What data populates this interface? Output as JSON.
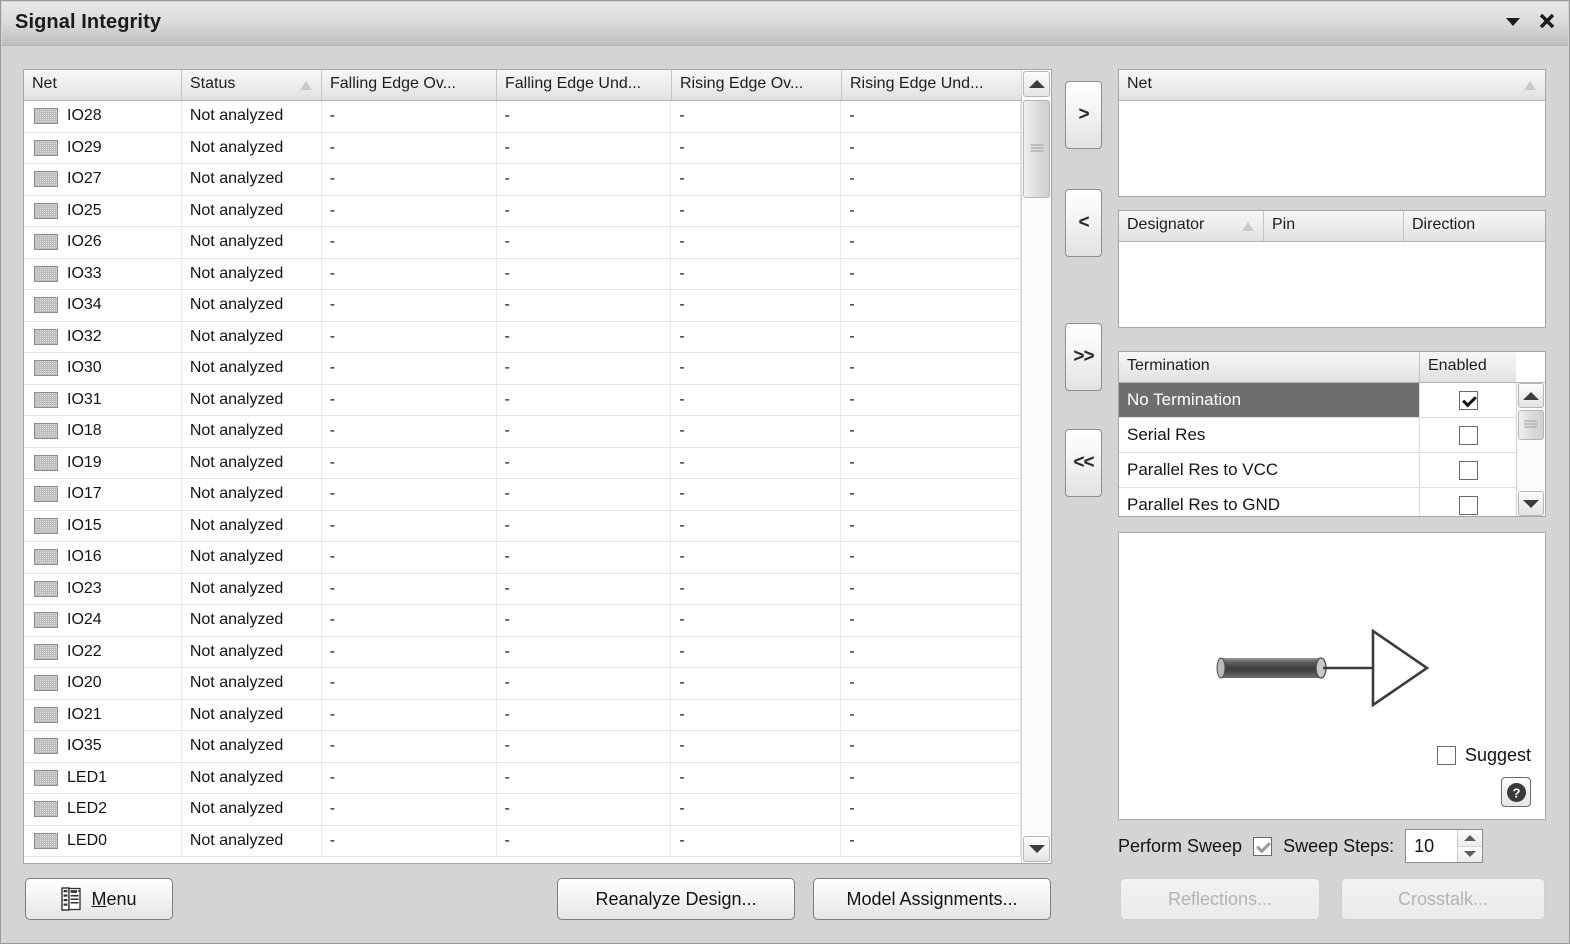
{
  "window": {
    "title": "Signal Integrity",
    "caret_icon": "chevron-down-icon",
    "close_icon": "close-icon"
  },
  "nets_grid": {
    "columns": [
      {
        "label": "Net",
        "sorted": false
      },
      {
        "label": "Status",
        "sorted": true
      },
      {
        "label": "Falling Edge Ov...",
        "sorted": false
      },
      {
        "label": "Falling Edge Und...",
        "sorted": false
      },
      {
        "label": "Rising Edge Ov...",
        "sorted": false
      },
      {
        "label": "Rising Edge Und...",
        "sorted": false
      }
    ],
    "rows": [
      {
        "net": "IO28",
        "status": "Not analyzed",
        "fall_over": "-",
        "fall_under": "-",
        "rise_over": "-",
        "rise_under": "-"
      },
      {
        "net": "IO29",
        "status": "Not analyzed",
        "fall_over": "-",
        "fall_under": "-",
        "rise_over": "-",
        "rise_under": "-"
      },
      {
        "net": "IO27",
        "status": "Not analyzed",
        "fall_over": "-",
        "fall_under": "-",
        "rise_over": "-",
        "rise_under": "-"
      },
      {
        "net": "IO25",
        "status": "Not analyzed",
        "fall_over": "-",
        "fall_under": "-",
        "rise_over": "-",
        "rise_under": "-"
      },
      {
        "net": "IO26",
        "status": "Not analyzed",
        "fall_over": "-",
        "fall_under": "-",
        "rise_over": "-",
        "rise_under": "-"
      },
      {
        "net": "IO33",
        "status": "Not analyzed",
        "fall_over": "-",
        "fall_under": "-",
        "rise_over": "-",
        "rise_under": "-"
      },
      {
        "net": "IO34",
        "status": "Not analyzed",
        "fall_over": "-",
        "fall_under": "-",
        "rise_over": "-",
        "rise_under": "-"
      },
      {
        "net": "IO32",
        "status": "Not analyzed",
        "fall_over": "-",
        "fall_under": "-",
        "rise_over": "-",
        "rise_under": "-"
      },
      {
        "net": "IO30",
        "status": "Not analyzed",
        "fall_over": "-",
        "fall_under": "-",
        "rise_over": "-",
        "rise_under": "-"
      },
      {
        "net": "IO31",
        "status": "Not analyzed",
        "fall_over": "-",
        "fall_under": "-",
        "rise_over": "-",
        "rise_under": "-"
      },
      {
        "net": "IO18",
        "status": "Not analyzed",
        "fall_over": "-",
        "fall_under": "-",
        "rise_over": "-",
        "rise_under": "-"
      },
      {
        "net": "IO19",
        "status": "Not analyzed",
        "fall_over": "-",
        "fall_under": "-",
        "rise_over": "-",
        "rise_under": "-"
      },
      {
        "net": "IO17",
        "status": "Not analyzed",
        "fall_over": "-",
        "fall_under": "-",
        "rise_over": "-",
        "rise_under": "-"
      },
      {
        "net": "IO15",
        "status": "Not analyzed",
        "fall_over": "-",
        "fall_under": "-",
        "rise_over": "-",
        "rise_under": "-"
      },
      {
        "net": "IO16",
        "status": "Not analyzed",
        "fall_over": "-",
        "fall_under": "-",
        "rise_over": "-",
        "rise_under": "-"
      },
      {
        "net": "IO23",
        "status": "Not analyzed",
        "fall_over": "-",
        "fall_under": "-",
        "rise_over": "-",
        "rise_under": "-"
      },
      {
        "net": "IO24",
        "status": "Not analyzed",
        "fall_over": "-",
        "fall_under": "-",
        "rise_over": "-",
        "rise_under": "-"
      },
      {
        "net": "IO22",
        "status": "Not analyzed",
        "fall_over": "-",
        "fall_under": "-",
        "rise_over": "-",
        "rise_under": "-"
      },
      {
        "net": "IO20",
        "status": "Not analyzed",
        "fall_over": "-",
        "fall_under": "-",
        "rise_over": "-",
        "rise_under": "-"
      },
      {
        "net": "IO21",
        "status": "Not analyzed",
        "fall_over": "-",
        "fall_under": "-",
        "rise_over": "-",
        "rise_under": "-"
      },
      {
        "net": "IO35",
        "status": "Not analyzed",
        "fall_over": "-",
        "fall_under": "-",
        "rise_over": "-",
        "rise_under": "-"
      },
      {
        "net": "LED1",
        "status": "Not analyzed",
        "fall_over": "-",
        "fall_under": "-",
        "rise_over": "-",
        "rise_under": "-"
      },
      {
        "net": "LED2",
        "status": "Not analyzed",
        "fall_over": "-",
        "fall_under": "-",
        "rise_over": "-",
        "rise_under": "-"
      },
      {
        "net": "LED0",
        "status": "Not analyzed",
        "fall_over": "-",
        "fall_under": "-",
        "rise_over": "-",
        "rise_under": "-"
      }
    ],
    "scrollbar": {
      "up_icon": "chevron-up-icon",
      "down_icon": "chevron-down-icon"
    }
  },
  "transfer_buttons": [
    {
      "label": ">",
      "name": "move-right-button"
    },
    {
      "label": "<",
      "name": "move-left-button"
    },
    {
      "label": ">>",
      "name": "move-all-right-button"
    },
    {
      "label": "<<",
      "name": "move-all-left-button"
    }
  ],
  "selected_net_panel": {
    "columns": [
      {
        "label": "Net",
        "sorted": true
      }
    ],
    "rows": []
  },
  "pins_panel": {
    "columns": [
      {
        "label": "Designator",
        "sorted": true
      },
      {
        "label": "Pin",
        "sorted": false
      },
      {
        "label": "Direction",
        "sorted": false
      }
    ],
    "rows": []
  },
  "termination_panel": {
    "columns": [
      {
        "label": "Termination"
      },
      {
        "label": "Enabled"
      }
    ],
    "rows": [
      {
        "label": "No Termination",
        "enabled": true,
        "selected": true
      },
      {
        "label": "Serial Res",
        "enabled": false,
        "selected": false
      },
      {
        "label": "Parallel Res to VCC",
        "enabled": false,
        "selected": false
      },
      {
        "label": "Parallel Res to GND",
        "enabled": false,
        "selected": false
      }
    ],
    "scrollbar": {
      "up_icon": "chevron-up-icon",
      "down_icon": "chevron-down-icon"
    }
  },
  "preview_panel": {
    "diagram_icon": "transmission-line-buffer-diagram",
    "suggest_label": "Suggest",
    "suggest_checked": false,
    "help_icon": "help-question-icon"
  },
  "sweep": {
    "perform_label": "Perform Sweep",
    "perform_checked": true,
    "steps_label": "Sweep Steps:",
    "steps_value": "10",
    "up_icon": "spinner-up-icon",
    "down_icon": "spinner-down-icon"
  },
  "footer": {
    "menu_label": "Menu",
    "menu_icon": "menu-list-icon",
    "reanalyze_label": "Reanalyze Design...",
    "model_assignments_label": "Model Assignments...",
    "reflections_label": "Reflections...",
    "reflections_disabled": true,
    "crosstalk_label": "Crosstalk...",
    "crosstalk_disabled": true
  },
  "colors": {
    "selection": "#6e6e6e",
    "window_bg": "#d4d4d4",
    "panel_bg": "#ffffff"
  }
}
